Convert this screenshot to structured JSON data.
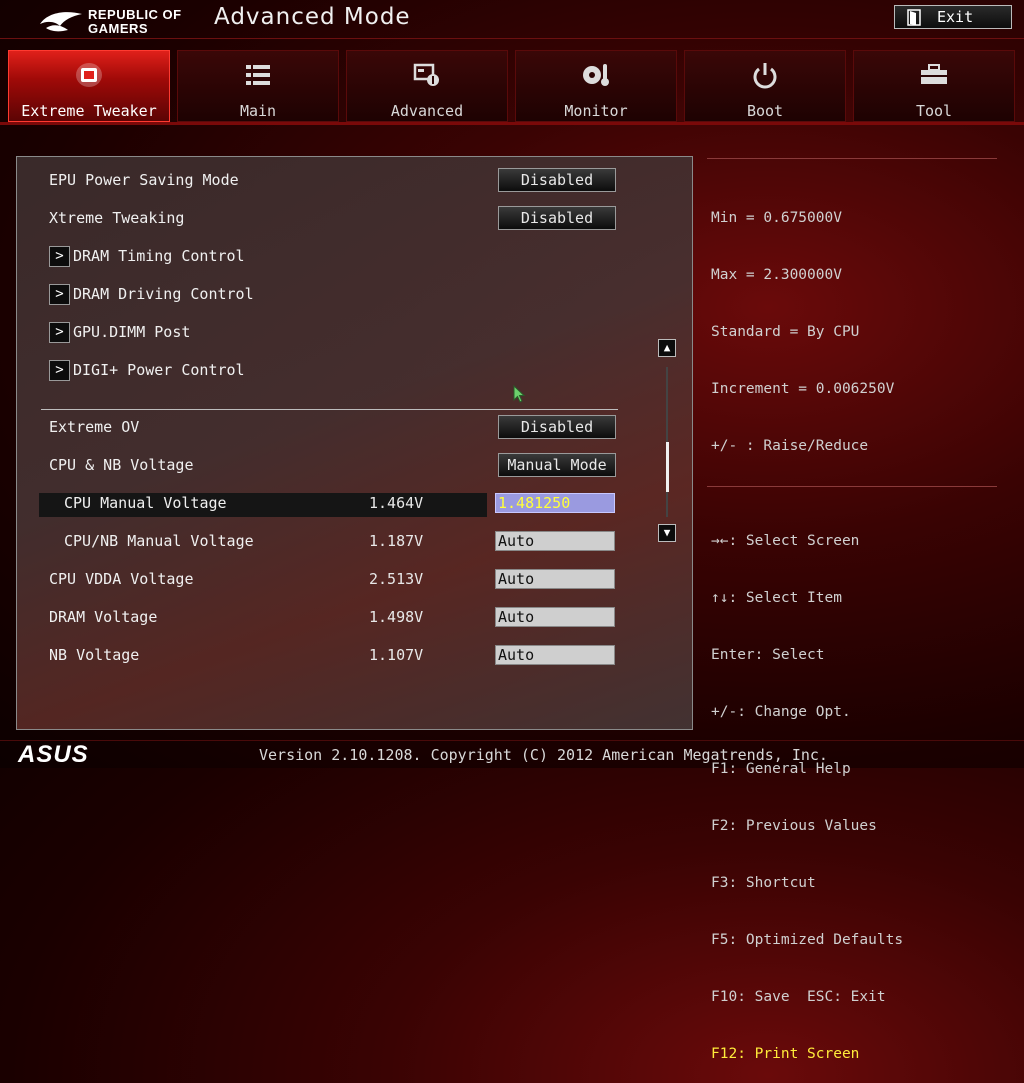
{
  "header": {
    "logo_line1": "REPUBLIC OF",
    "logo_line2": "GAMERS",
    "title": "Advanced Mode",
    "exit_label": "Exit"
  },
  "tabs": [
    {
      "label": "Extreme Tweaker",
      "icon": "chip-icon",
      "active": true
    },
    {
      "label": "Main",
      "icon": "list-icon",
      "active": false
    },
    {
      "label": "Advanced",
      "icon": "advanced-settings-icon",
      "active": false
    },
    {
      "label": "Monitor",
      "icon": "thermometer-fan-icon",
      "active": false
    },
    {
      "label": "Boot",
      "icon": "power-icon",
      "active": false
    },
    {
      "label": "Tool",
      "icon": "toolbox-icon",
      "active": false
    }
  ],
  "settings": {
    "epu_power_saving": {
      "label": "EPU Power Saving Mode",
      "value": "Disabled"
    },
    "xtreme_tweaking": {
      "label": "Xtreme Tweaking",
      "value": "Disabled"
    },
    "submenus": [
      "DRAM Timing Control",
      "DRAM Driving Control",
      "GPU.DIMM Post",
      "DIGI+ Power Control"
    ],
    "extreme_ov": {
      "label": "Extreme OV",
      "value": "Disabled"
    },
    "cpu_nb_voltage": {
      "label": "CPU & NB Voltage",
      "value": "Manual Mode"
    },
    "cpu_manual_voltage": {
      "label": "CPU Manual Voltage",
      "reading": "1.464V",
      "value": "1.481250"
    },
    "cpu_nb_manual_voltage": {
      "label": "CPU/NB Manual Voltage",
      "reading": "1.187V",
      "value": "Auto"
    },
    "cpu_vdda_voltage": {
      "label": "CPU VDDA Voltage",
      "reading": "2.513V",
      "value": "Auto"
    },
    "dram_voltage": {
      "label": "DRAM Voltage",
      "reading": "1.498V",
      "value": "Auto"
    },
    "nb_voltage": {
      "label": "NB Voltage",
      "reading": "1.107V",
      "value": "Auto"
    }
  },
  "item_help": [
    "Min = 0.675000V",
    "Max = 2.300000V",
    "Standard = By CPU",
    "Increment = 0.006250V",
    "+/- : Raise/Reduce"
  ],
  "key_help": [
    "→←: Select Screen",
    "↑↓: Select Item",
    "Enter: Select",
    "+/-: Change Opt.",
    "F1: General Help",
    "F2: Previous Values",
    "F3: Shortcut",
    "F5: Optimized Defaults",
    "F10: Save  ESC: Exit"
  ],
  "key_help_highlight": "F12: Print Screen",
  "footer": {
    "brand": "ASUS",
    "version": "Version 2.10.1208. Copyright (C) 2012 American Megatrends, Inc."
  },
  "colors": {
    "accent_red": "#e0201a",
    "selected_field": "#9a9ae0",
    "selected_text": "#ffff3a",
    "hotkey_text": "#ffeb3a"
  }
}
